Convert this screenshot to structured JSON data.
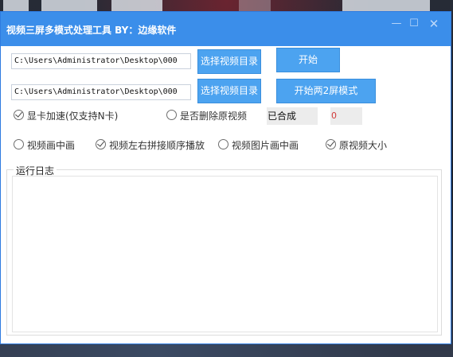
{
  "window": {
    "title": "视频三屏多模式处理工具 BY：边缘软件",
    "controls": {
      "minimize": "—",
      "maximize": "☐",
      "close": "✕"
    }
  },
  "paths": {
    "dir1_value": "C:\\Users\\Administrator\\Desktop\\000",
    "dir2_value": "C:\\Users\\Administrator\\Desktop\\000"
  },
  "buttons": {
    "select_dir1": "选择视频目录",
    "select_dir2": "选择视频目录",
    "start": "开始",
    "start_two_screen": "开始两2屏模式"
  },
  "options": {
    "gpu_accel": {
      "label": "显卡加速(仅支持N卡)",
      "checked": true
    },
    "delete_source": {
      "label": "是否删除原视频",
      "checked": false
    },
    "pip_video": {
      "label": "视频画中画",
      "checked": false
    },
    "lr_concat": {
      "label": "视频左右拼接顺序播放",
      "checked": true
    },
    "pip_image": {
      "label": "视频图片画中画",
      "checked": false
    },
    "original_size": {
      "label": "原视频大小",
      "checked": true
    }
  },
  "status": {
    "merged_label": "已合成",
    "merged_count": "0"
  },
  "log": {
    "title": "运行日志",
    "content": ""
  },
  "colors": {
    "titlebar": "#3b8eea",
    "button": "#4ca3f0",
    "count_text": "#d23a3a"
  }
}
